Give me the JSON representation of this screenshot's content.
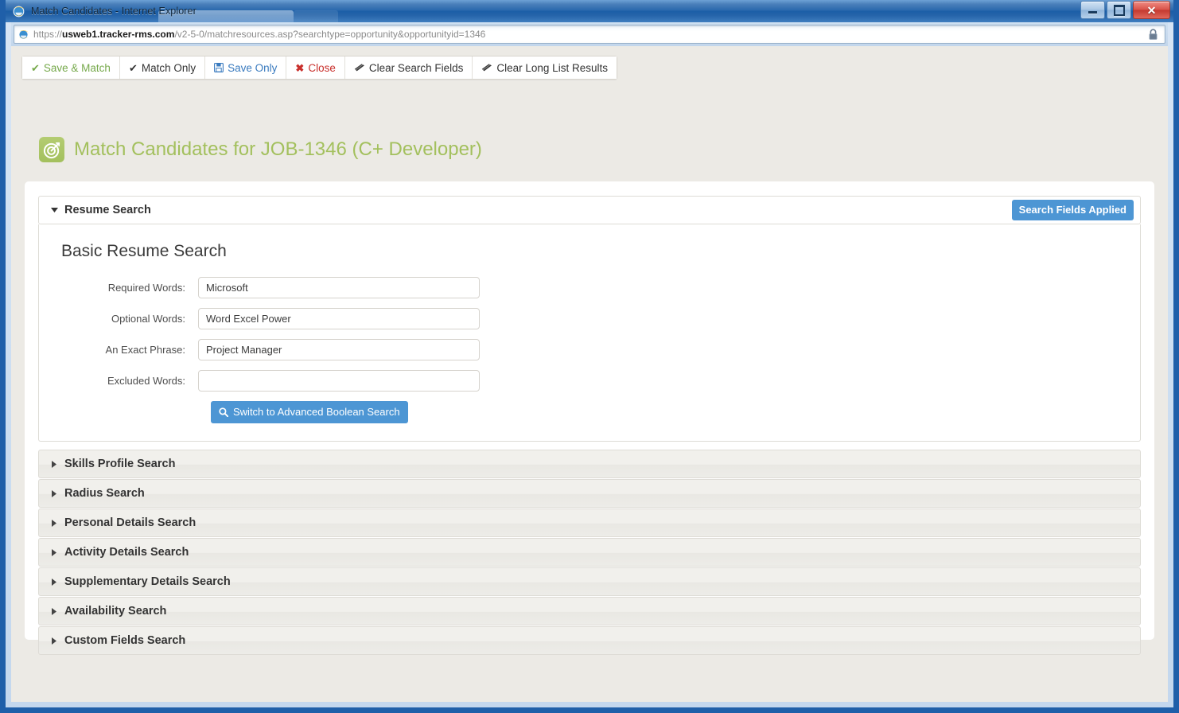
{
  "window": {
    "title": "Match Candidates - Internet Explorer",
    "icon": "internet-explorer-icon",
    "minimize_label": "–",
    "maximize_label": "□",
    "close_label": "✕"
  },
  "address_bar": {
    "url_protocol": "https://",
    "url_host_bold": "usweb1.tracker-rms.com",
    "url_path": "/v2-5-0/matchresources.asp?searchtype=opportunity&opportunityid=1346",
    "full_url": "https://usweb1.tracker-rms.com/v2-5-0/matchresources.asp?searchtype=opportunity&opportunityid=1346",
    "lock_icon": "padlock-icon"
  },
  "toolbar": {
    "buttons": [
      {
        "label": "Save & Match",
        "icon": "check-icon",
        "style": "green"
      },
      {
        "label": "Match Only",
        "icon": "check-icon",
        "style": "dark"
      },
      {
        "label": "Save Only",
        "icon": "floppy-disk-icon",
        "style": "blue"
      },
      {
        "label": "Close",
        "icon": "x-icon",
        "style": "red"
      },
      {
        "label": "Clear Search Fields",
        "icon": "eraser-icon",
        "style": "dark"
      },
      {
        "label": "Clear Long List Results",
        "icon": "eraser-icon",
        "style": "dark"
      }
    ]
  },
  "page_header": {
    "icon": "target-bullseye-icon",
    "title": "Match Candidates for JOB-1346 (C+ Developer)"
  },
  "resume_search": {
    "header": "Resume Search",
    "expanded": true,
    "badge": "Search Fields Applied",
    "section_heading": "Basic Resume Search",
    "fields": [
      {
        "label": "Required Words:",
        "value": "Microsoft",
        "placeholder": ""
      },
      {
        "label": "Optional Words:",
        "value": "Word Excel Power",
        "placeholder": ""
      },
      {
        "label": "An Exact Phrase:",
        "value": "Project Manager",
        "placeholder": ""
      },
      {
        "label": "Excluded Words:",
        "value": "",
        "placeholder": ""
      }
    ],
    "switch_button": {
      "label": "Switch to Advanced Boolean Search",
      "icon": "search-icon"
    }
  },
  "collapsed_sections": [
    {
      "label": "Skills Profile Search"
    },
    {
      "label": "Radius Search"
    },
    {
      "label": "Personal Details Search"
    },
    {
      "label": "Activity Details Search"
    },
    {
      "label": "Supplementary Details Search"
    },
    {
      "label": "Availability Search"
    },
    {
      "label": "Custom Fields Search"
    }
  ],
  "colors": {
    "accent_green": "#a3c05d",
    "accent_blue": "#4d96d4",
    "danger_red": "#c9302c",
    "page_bg": "#eceae5",
    "panel_bg": "#ffffff"
  }
}
